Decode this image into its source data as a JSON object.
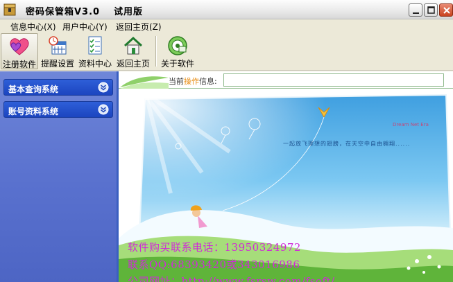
{
  "window": {
    "title": "密码保管箱V3.0",
    "edition": "试用版"
  },
  "menu": {
    "items": [
      {
        "label": "信息中心(X)"
      },
      {
        "label": "用户中心(Y)"
      },
      {
        "label": "返回主页(Z)"
      }
    ]
  },
  "toolbar": {
    "items": [
      {
        "label": "注册软件",
        "icon": "heart-icon"
      },
      {
        "label": "提醒设置",
        "icon": "calendar-clock-icon"
      },
      {
        "label": "资料中心",
        "icon": "checklist-icon"
      },
      {
        "label": "返回主页",
        "icon": "home-icon"
      },
      {
        "label": "关于软件",
        "icon": "about-icon"
      }
    ]
  },
  "sidebar": {
    "sections": [
      {
        "label": "基本查询系统"
      },
      {
        "label": "账号资料系统"
      }
    ]
  },
  "info": {
    "label_prefix": "当前",
    "label_highlight": "操作",
    "label_suffix": "信息:",
    "value": ""
  },
  "banner": {
    "caption": "一起放飞理想的翅膀，在天空中自由翱翔......",
    "logo": "Dream Net Era",
    "phone": "软件购买联系电话：13950324972",
    "qq": "联系QQ:68393420或343016986",
    "site": "公司网址：http://www.fsrsw.com/fsoft/"
  },
  "colors": {
    "sidebar": "#5a72cf",
    "section_header": "#1c45bf",
    "promo_text": "#d12ad8",
    "sky": "#4fb0e8"
  }
}
